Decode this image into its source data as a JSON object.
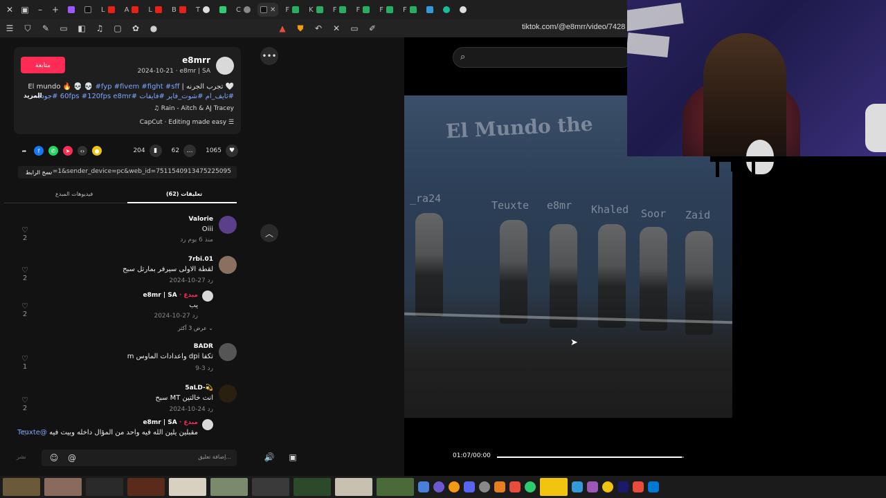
{
  "browser": {
    "url": "tiktok.com/@e8mrr/video/7428",
    "tabs": [
      "L",
      "A",
      "L",
      "B",
      "T",
      "C",
      "F",
      "K",
      "F",
      "F",
      "F",
      "F"
    ]
  },
  "post": {
    "follow_label": "متابعة",
    "username": "e8mrr",
    "date_line": "2024-10-21 · e8mr | SA",
    "desc_line1_text": "🤍 تجرب الجرنه | El mundo 🔥 💀 💀",
    "desc_line1_tags": "#fyp #fivem #fight #sff",
    "desc_line2": "#ثايف_ام #شوت_فاير #فايفات #60fps #120fps e8mr #جوده...",
    "more_label": "المزيد",
    "music": "♫ Rain - Aitch & AJ Tracey",
    "capcut": "CapCut · Editing made easy"
  },
  "stats": {
    "likes": "1065",
    "comments": "62",
    "saves": "204"
  },
  "link": {
    "copy_label": "نسخ الرابط",
    "text": "...=1&sender_device=pc&web_id=7511540913475225095"
  },
  "tabs": {
    "comments": "تعليقات (62)",
    "creator_videos": "فيديوهات المبدع"
  },
  "comments": [
    {
      "name": "Valorie",
      "text": "Oiii",
      "meta": "منذ 6 يوم   رد",
      "likes": "2"
    },
    {
      "name": "7rbi.01",
      "text": "لقطة الاولى سيرفر بمارتل سبح",
      "meta": "2024-10-27   رد",
      "likes": "2"
    },
    {
      "name": "e8mr | SA",
      "creator": "· مبدع",
      "text": "يب",
      "meta": "2024-10-27   رد",
      "likes": "2"
    },
    {
      "name": "BADR",
      "text": "تكفا dpi واعدادات الماوس m",
      "meta": "9-3   رد",
      "likes": "1"
    },
    {
      "name": "5aLD-💫",
      "text": "انت خالتين MT سبح",
      "meta": "2024-10-24   رد",
      "likes": "2"
    },
    {
      "name": "e8mr | SA",
      "creator": "· مبدع",
      "text": "مقبلين يلين الله فيه واحد من المؤال داخله وبيت فيه",
      "mention": "@Teuxte",
      "likes": ""
    }
  ],
  "view_more": "عرض 3 أكثر ⌄",
  "comment_box": {
    "placeholder": "إضافة تعليق...",
    "post_label": "نشر"
  },
  "video": {
    "overlay_title": "El Mundo the",
    "names": [
      "_ra24",
      "Teuxte",
      "e8mr",
      "Khaled",
      "Soor",
      "Zaid"
    ],
    "time": "01:07/00:00",
    "progress": 0.99
  },
  "colors": {
    "accent": "#fe2c55",
    "tag": "#7ea7ff"
  }
}
